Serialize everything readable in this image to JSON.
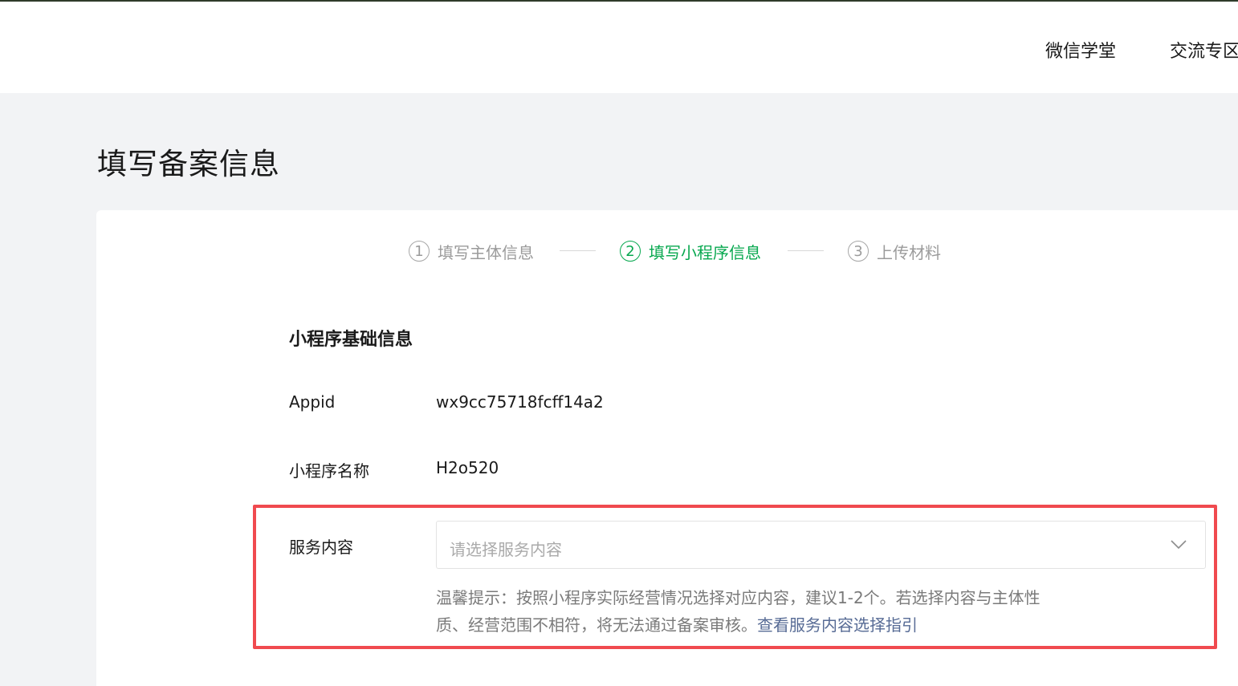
{
  "header": {
    "nav": [
      "微信学堂",
      "交流专区"
    ]
  },
  "page": {
    "title": "填写备案信息"
  },
  "steps": [
    {
      "num": "1",
      "label": "填写主体信息",
      "state": "done"
    },
    {
      "num": "2",
      "label": "填写小程序信息",
      "state": "active"
    },
    {
      "num": "3",
      "label": "上传材料",
      "state": "pending"
    }
  ],
  "form": {
    "section_title": "小程序基础信息",
    "appid_label": "Appid",
    "appid_value": "wx9cc75718fcff14a2",
    "name_label": "小程序名称",
    "name_value": "H2o520",
    "service_label": "服务内容",
    "service_placeholder": "请选择服务内容",
    "tip_text": "温馨提示：按照小程序实际经营情况选择对应内容，建议1-2个。若选择内容与主体性质、经营范围不相符，将无法通过备案审核。",
    "tip_link": "查看服务内容选择指引"
  },
  "colors": {
    "accent": "#07a84f",
    "highlight_border": "#f04a4f",
    "link": "#576b95"
  }
}
